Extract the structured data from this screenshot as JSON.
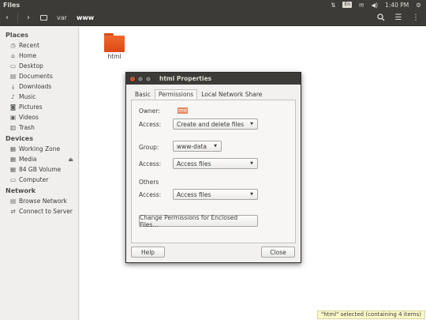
{
  "panel": {
    "app_name": "Files",
    "keyboard_layout": "En",
    "clock": "1:40 PM",
    "icons": [
      "network-updown-icon",
      "keyboard-icon",
      "mail-envelope-icon",
      "volume-icon",
      "clock",
      "gear-icon"
    ]
  },
  "toolbar": {
    "back": "‹",
    "forward": "›",
    "breadcrumbs": [
      "var",
      "www"
    ]
  },
  "sidebar": {
    "places_heading": "Places",
    "places": [
      {
        "label": "Recent",
        "icon": "clock-icon"
      },
      {
        "label": "Home",
        "icon": "home-icon"
      },
      {
        "label": "Desktop",
        "icon": "desktop-folder-icon"
      },
      {
        "label": "Documents",
        "icon": "documents-folder-icon"
      },
      {
        "label": "Downloads",
        "icon": "downloads-icon"
      },
      {
        "label": "Music",
        "icon": "music-icon"
      },
      {
        "label": "Pictures",
        "icon": "camera-icon"
      },
      {
        "label": "Videos",
        "icon": "videos-icon"
      },
      {
        "label": "Trash",
        "icon": "trash-icon"
      }
    ],
    "devices_heading": "Devices",
    "devices": [
      {
        "label": "Working Zone",
        "icon": "drive-icon"
      },
      {
        "label": "Media",
        "icon": "drive-icon"
      },
      {
        "label": "84 GB Volume",
        "icon": "drive-icon"
      },
      {
        "label": "Computer",
        "icon": "computer-icon"
      }
    ],
    "network_heading": "Network",
    "network": [
      {
        "label": "Browse Network",
        "icon": "network-icon"
      },
      {
        "label": "Connect to Server",
        "icon": "server-icon"
      }
    ]
  },
  "content": {
    "folder_label": "html",
    "status": "\"html\" selected  (containing 4 items)"
  },
  "dialog": {
    "title": "html Properties",
    "tabs": [
      "Basic",
      "Permissions",
      "Local Network Share"
    ],
    "active_tab": "Permissions",
    "owner_label": "Owner:",
    "owner_value": "me",
    "access_label": "Access:",
    "owner_access": "Create and delete files",
    "group_label": "Group:",
    "group_value": "www-data",
    "group_access": "Access files",
    "others_heading": "Others",
    "others_access": "Access files",
    "enclosed_button": "Change Permissions for Enclosed Files…",
    "help_button": "Help",
    "close_button": "Close"
  },
  "colors": {
    "panel": "#3c3b37",
    "accent_orange": "#dd4814",
    "status_bg": "#fbf9c9"
  }
}
